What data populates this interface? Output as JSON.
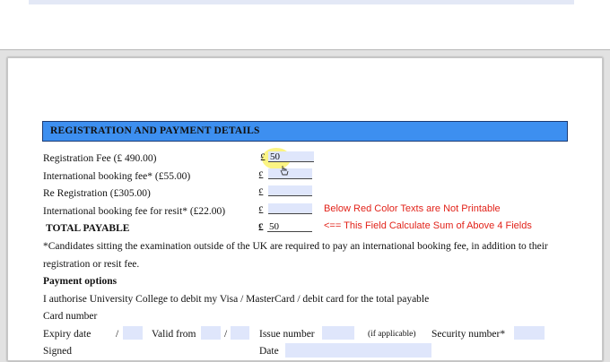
{
  "header": {
    "title": "REGISTRATION AND PAYMENT DETAILS"
  },
  "currency": "£",
  "fees": [
    {
      "label": "Registration Fee (£ 490.00)",
      "value": "50"
    },
    {
      "label": "International booking fee* (£55.00)",
      "value": ""
    },
    {
      "label": "Re Registration (£305.00)",
      "value": ""
    },
    {
      "label": "International booking fee for resit* (£22.00)",
      "value": ""
    }
  ],
  "total": {
    "label": "TOTAL PAYABLE",
    "value": "50"
  },
  "notes": {
    "not_printable": "Below Red Color Texts are Not Printable",
    "sum_field": "<== This Field Calculate Sum of Above 4 Fields"
  },
  "disclaimer_line1": "*Candidates sitting the examination outside of the UK are required to pay an international booking fee, in addition to their",
  "disclaimer_line2": "registration or resit fee.",
  "payment": {
    "heading": "Payment options",
    "authorise": "I authorise University College to debit my Visa / MasterCard / debit card for the total payable",
    "card_number": "Card number",
    "expiry": "Expiry date",
    "slash": "/",
    "valid_from": "Valid from",
    "issue_number": "Issue number",
    "if_applicable": "(if applicable)",
    "security_number": "Security number*",
    "signed": "Signed",
    "date": "Date"
  },
  "colors": {
    "header_blue": "#3d8ff0",
    "field_fill": "#dfe6fb",
    "note_red": "#e2231a"
  }
}
